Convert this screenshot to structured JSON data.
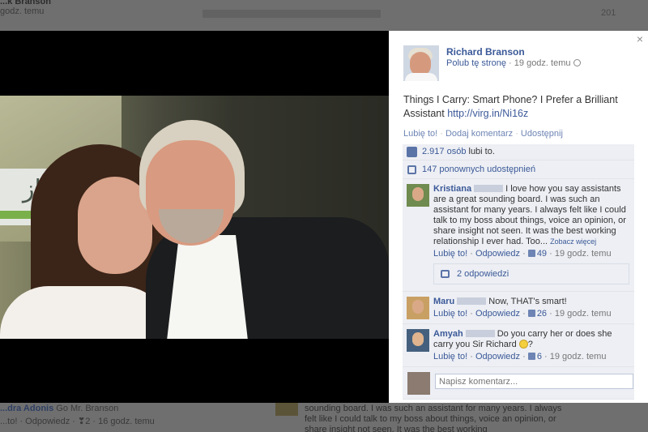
{
  "background": {
    "top_name": "...k Branson",
    "top_meta": "godz. temu",
    "year": "201",
    "bottom_comment_name": "...dra Adonis",
    "bottom_comment_text": "Go Mr. Branson",
    "bottom_comment_meta": "...to! · Odpowiedz · ❣2 · 16 godz. temu",
    "bottom_right_text": "sounding board. I was such an assistant for many years. I always felt like I could talk to my boss about things, voice an opinion, or share insight not seen. It was the best working"
  },
  "photo": {
    "sign_text": "إنجاز",
    "sign_sub": "معـ"
  },
  "panel": {
    "close": "×",
    "page_name": "Richard Branson",
    "like_page": "Polub tę stronę",
    "time": "19 godz. temu",
    "post_text": "Things I Carry: Smart Phone? I Prefer a Brilliant Assistant ",
    "post_link": "http://virg.in/Ni16z",
    "actions": {
      "like": "Lubię to!",
      "comment": "Dodaj komentarz",
      "share": "Udostępnij"
    },
    "likes": {
      "count": "2.917 osób",
      "suffix": " lubi to."
    },
    "shares": "147 ponownych udostępnień",
    "comments": [
      {
        "name": "Kristiana",
        "text": "I love how you say assistants are a great sounding board. I was such an assistant for many years. I always felt like I could talk to my boss about things, voice an opinion, or share insight not seen. It was the best working relationship I ever had. Too...",
        "more": "Zobacz więcej",
        "like": "Lubię to!",
        "reply": "Odpowiedz",
        "likes": "49",
        "time": "19 godz. temu",
        "replies": "2 odpowiedzi"
      },
      {
        "name": "Maru",
        "text": "Now, THAT's smart!",
        "like": "Lubię to!",
        "reply": "Odpowiedz",
        "likes": "26",
        "time": "19 godz. temu"
      },
      {
        "name": "Amyah",
        "text": "Do you carry her or does she carry you Sir Richard",
        "text_end": "?",
        "like": "Lubię to!",
        "reply": "Odpowiedz",
        "likes": "6",
        "time": "19 godz. temu"
      }
    ],
    "composer_placeholder": "Napisz komentarz..."
  }
}
